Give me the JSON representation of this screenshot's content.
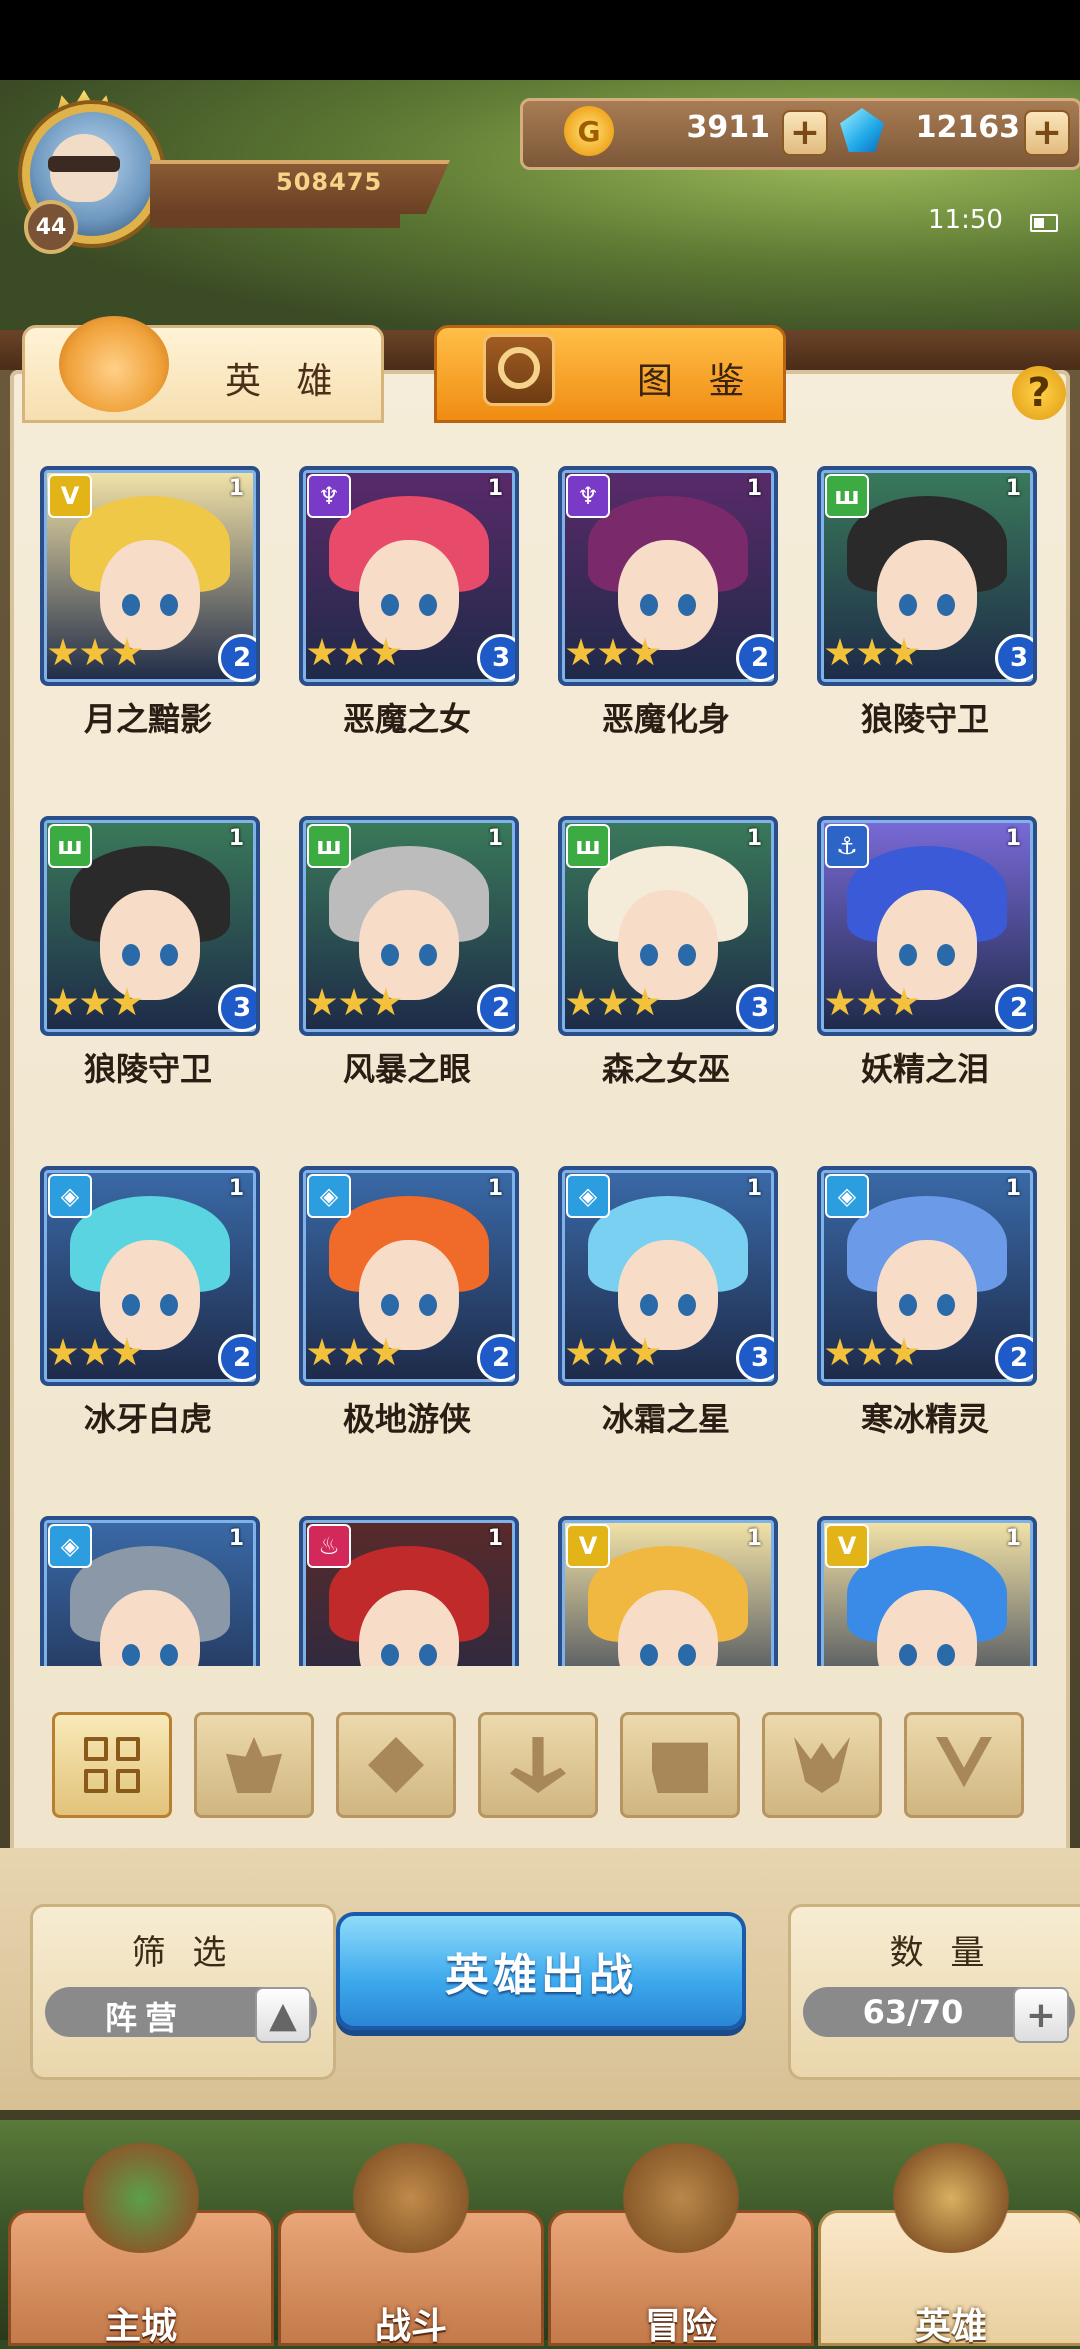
{
  "player": {
    "level": "44",
    "power": "508475"
  },
  "currency": {
    "gold": "3911",
    "gems": "12163"
  },
  "status": {
    "time": "11:50"
  },
  "tabs": {
    "hero": "英 雄",
    "codex": "图 鉴"
  },
  "help": "?",
  "heroes": [
    {
      "name": "月之黯影",
      "faction": "light",
      "stars": 3,
      "level": "2",
      "count": "1",
      "hair": "#f0c848"
    },
    {
      "name": "恶魔之女",
      "faction": "dark",
      "stars": 3,
      "level": "3",
      "count": "1",
      "hair": "#e84a6a"
    },
    {
      "name": "恶魔化身",
      "faction": "dark",
      "stars": 3,
      "level": "2",
      "count": "1",
      "hair": "#7a2a6a"
    },
    {
      "name": "狼陵守卫",
      "faction": "nature",
      "stars": 3,
      "level": "3",
      "count": "1",
      "hair": "#2a2a2a"
    },
    {
      "name": "狼陵守卫",
      "faction": "nature",
      "stars": 3,
      "level": "3",
      "count": "1",
      "hair": "#2a2a2a"
    },
    {
      "name": "风暴之眼",
      "faction": "nature",
      "stars": 3,
      "level": "2",
      "count": "1",
      "hair": "#bcbcbc"
    },
    {
      "name": "森之女巫",
      "faction": "nature",
      "stars": 3,
      "level": "3",
      "count": "1",
      "hair": "#f4ecd8"
    },
    {
      "name": "妖精之泪",
      "faction": "water",
      "stars": 3,
      "level": "2",
      "count": "1",
      "hair": "#3a5ad8"
    },
    {
      "name": "冰牙白虎",
      "faction": "ice",
      "stars": 3,
      "level": "2",
      "count": "1",
      "hair": "#5ad4e0"
    },
    {
      "name": "极地游侠",
      "faction": "ice",
      "stars": 3,
      "level": "2",
      "count": "1",
      "hair": "#f06a2a"
    },
    {
      "name": "冰霜之星",
      "faction": "ice",
      "stars": 3,
      "level": "3",
      "count": "1",
      "hair": "#7ad0f0"
    },
    {
      "name": "寒冰精灵",
      "faction": "ice",
      "stars": 3,
      "level": "2",
      "count": "1",
      "hair": "#6a9ae8"
    },
    {
      "name": "",
      "faction": "ice",
      "stars": 0,
      "level": "",
      "count": "1",
      "hair": "#8a98a8"
    },
    {
      "name": "",
      "faction": "fire",
      "stars": 0,
      "level": "",
      "count": "1",
      "hair": "#c02a2a"
    },
    {
      "name": "",
      "faction": "light",
      "stars": 0,
      "level": "",
      "count": "1",
      "hair": "#f0b840"
    },
    {
      "name": "",
      "faction": "light",
      "stars": 0,
      "level": "",
      "count": "1",
      "hair": "#3a8ae8"
    }
  ],
  "filters": [
    "all",
    "fire",
    "ice",
    "water",
    "nature",
    "dark",
    "light"
  ],
  "actions": {
    "filter_title": "筛 选",
    "filter_value": "阵营",
    "deploy": "英雄出战",
    "count_title": "数 量",
    "count_value": "63/70"
  },
  "nav": [
    {
      "label": "主城",
      "active": false
    },
    {
      "label": "战斗",
      "active": false
    },
    {
      "label": "冒险",
      "active": false
    },
    {
      "label": "英雄",
      "active": true
    }
  ]
}
